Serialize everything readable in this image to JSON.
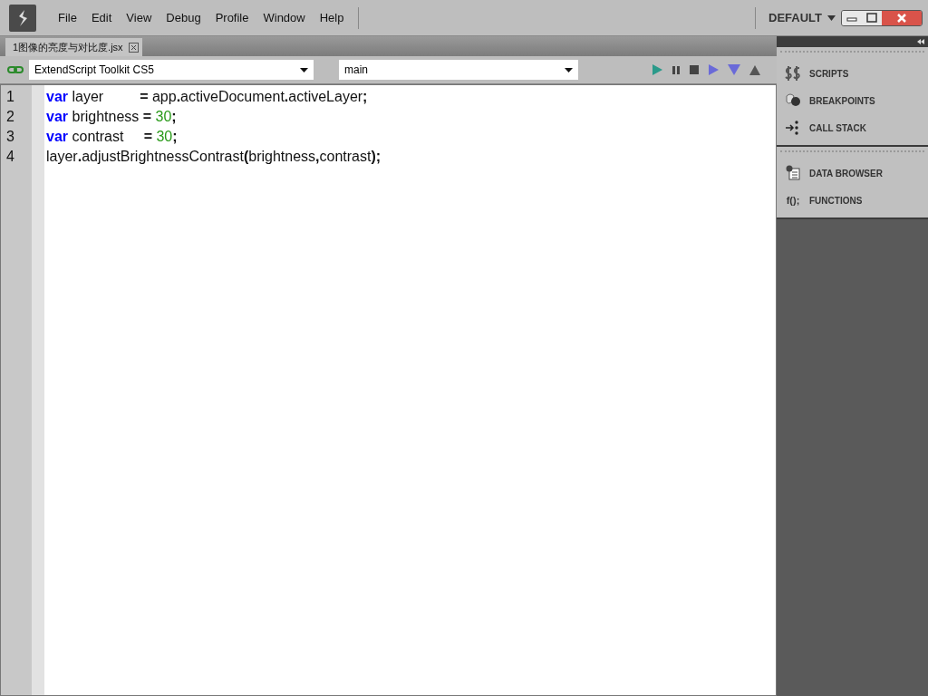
{
  "menu": [
    "File",
    "Edit",
    "View",
    "Debug",
    "Profile",
    "Window",
    "Help"
  ],
  "workspace": {
    "label": "DEFAULT"
  },
  "document_tab": {
    "label": "1图像的亮度与对比度.jsx",
    "selected": true
  },
  "toolbar": {
    "target": "ExtendScript Toolkit CS5",
    "function": "main"
  },
  "code_lines": [
    {
      "number": "1",
      "tokens": [
        {
          "kind": "keyword",
          "text": "var"
        },
        {
          "kind": "ident",
          "text": " layer         "
        },
        {
          "kind": "op",
          "text": "="
        },
        {
          "kind": "ident",
          "text": " app"
        },
        {
          "kind": "op",
          "text": "."
        },
        {
          "kind": "ident",
          "text": "activeDocument"
        },
        {
          "kind": "op",
          "text": "."
        },
        {
          "kind": "ident",
          "text": "activeLayer"
        },
        {
          "kind": "op",
          "text": ";"
        }
      ]
    },
    {
      "number": "2",
      "tokens": [
        {
          "kind": "keyword",
          "text": "var"
        },
        {
          "kind": "ident",
          "text": " brightness "
        },
        {
          "kind": "op",
          "text": "= "
        },
        {
          "kind": "number",
          "text": "30"
        },
        {
          "kind": "op",
          "text": ";"
        }
      ]
    },
    {
      "number": "3",
      "tokens": [
        {
          "kind": "keyword",
          "text": "var"
        },
        {
          "kind": "ident",
          "text": " contrast     "
        },
        {
          "kind": "op",
          "text": "= "
        },
        {
          "kind": "number",
          "text": "30"
        },
        {
          "kind": "op",
          "text": ";"
        }
      ]
    },
    {
      "number": "4",
      "tokens": [
        {
          "kind": "ident",
          "text": "layer"
        },
        {
          "kind": "op",
          "text": "."
        },
        {
          "kind": "ident",
          "text": "adjustBrightnessContrast"
        },
        {
          "kind": "op",
          "text": "("
        },
        {
          "kind": "ident",
          "text": "brightness"
        },
        {
          "kind": "op",
          "text": ","
        },
        {
          "kind": "ident",
          "text": "contrast"
        },
        {
          "kind": "op",
          "text": ");"
        }
      ]
    }
  ],
  "panel_groups": [
    [
      {
        "label": "SCRIPTS",
        "kind": "scripts"
      },
      {
        "label": "BREAKPOINTS",
        "kind": "breakpoints"
      },
      {
        "label": "CALL STACK",
        "kind": "callstack"
      }
    ],
    [
      {
        "label": "DATA BROWSER",
        "kind": "data"
      },
      {
        "label": "FUNCTIONS",
        "kind": "functions",
        "icon_text": "f();"
      }
    ]
  ]
}
